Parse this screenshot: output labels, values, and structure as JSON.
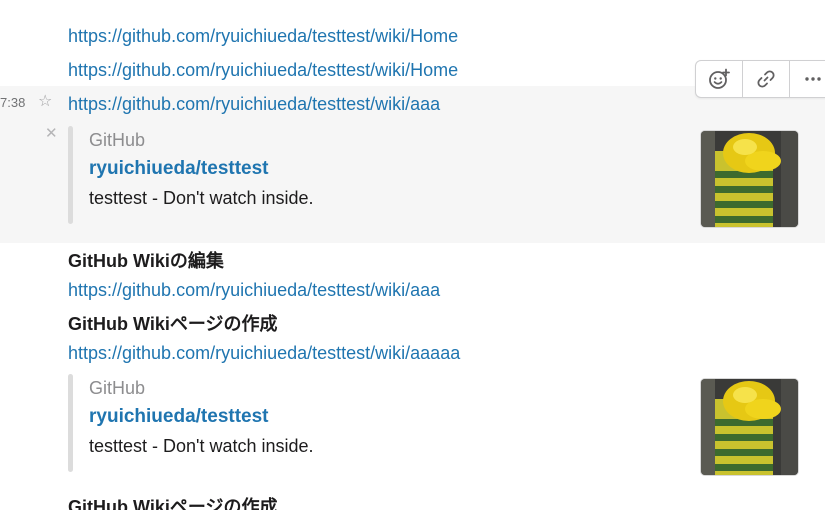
{
  "messages": [
    {
      "link": "https://github.com/ryuichiueda/testtest/wiki/Home"
    },
    {
      "link": "https://github.com/ryuichiueda/testtest/wiki/Home"
    },
    {
      "time": "7:38",
      "link": "https://github.com/ryuichiueda/testtest/wiki/aaa",
      "attachment": {
        "service": "GitHub",
        "title": "ryuichiueda/testtest",
        "description": "testtest - Don't watch inside."
      }
    },
    {
      "heading": "GitHub Wikiの編集",
      "link": "https://github.com/ryuichiueda/testtest/wiki/aaa"
    },
    {
      "heading": "GitHub Wikiページの作成",
      "link": "https://github.com/ryuichiueda/testtest/wiki/aaaaa",
      "attachment": {
        "service": "GitHub",
        "title": "ryuichiueda/testtest",
        "description": "testtest - Don't watch inside."
      }
    },
    {
      "heading": "GitHub Wikiページの作成"
    }
  ],
  "icons": {
    "star": "star-icon",
    "close": "close-icon",
    "reaction": "add-reaction-icon",
    "copy_link": "link-icon",
    "more": "more-actions-icon"
  },
  "colors": {
    "link": "#1f75b0",
    "hover_background": "#f6f6f6",
    "attachment_bar": "#dcdcdc"
  }
}
